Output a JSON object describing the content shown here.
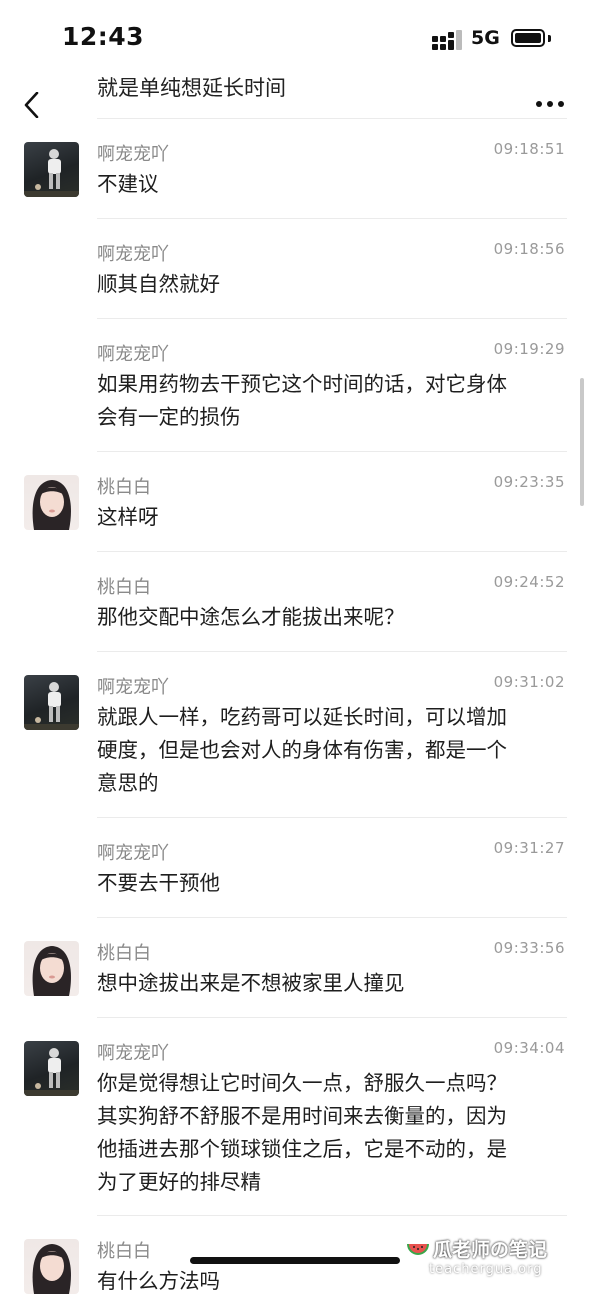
{
  "status_bar": {
    "time": "12:43",
    "network": "5G"
  },
  "header": {
    "partial_message": "就是单纯想延长时间"
  },
  "messages": [
    {
      "sender": "啊宠宠吖",
      "time": "09:18:51",
      "lines": [
        "不建议"
      ]
    },
    {
      "sender": "啊宠宠吖",
      "time": "09:18:56",
      "lines": [
        "顺其自然就好"
      ]
    },
    {
      "sender": "啊宠宠吖",
      "time": "09:19:29",
      "lines": [
        "如果用药物去干预它这个时间的话，对它身体",
        "会有一定的损伤"
      ]
    },
    {
      "sender": "桃白白",
      "time": "09:23:35",
      "lines": [
        "这样呀"
      ]
    },
    {
      "sender": "桃白白",
      "time": "09:24:52",
      "lines": [
        "那他交配中途怎么才能拔出来呢？"
      ]
    },
    {
      "sender": "啊宠宠吖",
      "time": "09:31:02",
      "lines": [
        "就跟人一样，吃药哥可以延长时间，可以增加",
        "硬度，但是也会对人的身体有伤害，都是一个",
        "意思的"
      ]
    },
    {
      "sender": "啊宠宠吖",
      "time": "09:31:27",
      "lines": [
        "不要去干预他"
      ]
    },
    {
      "sender": "桃白白",
      "time": "09:33:56",
      "lines": [
        "想中途拔出来是不想被家里人撞见"
      ]
    },
    {
      "sender": "啊宠宠吖",
      "time": "09:34:04",
      "lines": [
        "你是觉得想让它时间久一点，舒服久一点吗？",
        "其实狗舒不舒服不是用时间来去衡量的，因为",
        "他插进去那个锁球锁住之后，它是不动的，是",
        "为了更好的排尽精"
      ]
    },
    {
      "sender": "桃白白",
      "time": "",
      "lines": [
        "有什么方法吗"
      ]
    }
  ],
  "watermark": {
    "brand": "瓜老师の笔记",
    "url": "teachergua.org"
  }
}
